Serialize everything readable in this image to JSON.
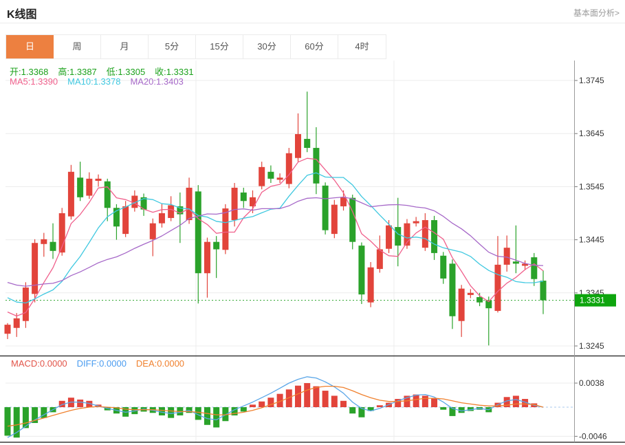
{
  "header": {
    "title": "K线图",
    "analysis_link": "基本面分析>"
  },
  "tabs": [
    {
      "id": "day",
      "label": "日",
      "active": true
    },
    {
      "id": "week",
      "label": "周",
      "active": false
    },
    {
      "id": "month",
      "label": "月",
      "active": false
    },
    {
      "id": "5min",
      "label": "5分",
      "active": false
    },
    {
      "id": "15min",
      "label": "15分",
      "active": false
    },
    {
      "id": "30min",
      "label": "30分",
      "active": false
    },
    {
      "id": "60min",
      "label": "60分",
      "active": false
    },
    {
      "id": "4hour",
      "label": "4时",
      "active": false
    }
  ],
  "ohlc_legend": {
    "color": "#1ba11b",
    "items": [
      {
        "label": "开:",
        "value": "1.3368"
      },
      {
        "label": "高:",
        "value": "1.3387"
      },
      {
        "label": "低:",
        "value": "1.3305"
      },
      {
        "label": "收:",
        "value": "1.3331"
      }
    ]
  },
  "ma_legend": [
    {
      "label": "MA5:",
      "value": "1.3390",
      "color": "#f0608c"
    },
    {
      "label": "MA10:",
      "value": "1.3378",
      "color": "#3fc8e0"
    },
    {
      "label": "MA20:",
      "value": "1.3403",
      "color": "#a668c8"
    }
  ],
  "macd_legend": [
    {
      "label": "MACD:",
      "value": "0.0000",
      "color": "#e25449"
    },
    {
      "label": "DIFF:",
      "value": "0.0000",
      "color": "#4a9cf0"
    },
    {
      "label": "DEA:",
      "value": "0.0000",
      "color": "#f0812e"
    }
  ],
  "price_badge": {
    "label": "1.3331",
    "color": "#0ea50e"
  },
  "colors": {
    "up": "#e2443b",
    "down": "#2aa22a",
    "grid": "#ececec",
    "axis": "#9a9a9a",
    "panel_border": "#3a3a3a",
    "ma5": "#f0608c",
    "ma10": "#3fc8e0",
    "ma20": "#a668c8",
    "diff": "#5aa6e8",
    "dea": "#f0812e",
    "zero_line": "#a9c9ec",
    "tick_text": "#333333",
    "dotted_price_line": "#2aa22a"
  },
  "chart_data": {
    "type": "candlestick+macd",
    "title": "K线图 daily candlestick with MA5/MA10/MA20 and MACD",
    "y_ticks": [
      {
        "price": 1.3745,
        "label": "1.3745"
      },
      {
        "price": 1.3645,
        "label": "1.3645"
      },
      {
        "price": 1.3545,
        "label": "1.3545"
      },
      {
        "price": 1.3445,
        "label": "1.3445"
      },
      {
        "price": 1.3345,
        "label": "1.3345"
      },
      {
        "price": 1.3245,
        "label": "1.3245"
      }
    ],
    "last_price": 1.3331,
    "ma_windows": [
      5,
      10,
      20
    ],
    "ma_seed": [
      1.34,
      1.3398,
      1.3396,
      1.34,
      1.3402,
      1.3398,
      1.3392,
      1.3388,
      1.3385,
      1.339,
      1.3386,
      1.338,
      1.3372,
      1.3362,
      1.3355,
      1.3345,
      1.3335,
      1.3322,
      1.3308,
      1.3295
    ],
    "candles": [
      [
        1.3268,
        1.3285,
        1.3288,
        1.3258
      ],
      [
        1.3279,
        1.3297,
        1.3307,
        1.3262
      ],
      [
        1.3292,
        1.3355,
        1.3365,
        1.3279
      ],
      [
        1.3343,
        1.3439,
        1.3446,
        1.3327
      ],
      [
        1.3437,
        1.3446,
        1.3458,
        1.3413
      ],
      [
        1.3441,
        1.3424,
        1.3476,
        1.3409
      ],
      [
        1.3421,
        1.3495,
        1.3505,
        1.3415
      ],
      [
        1.3489,
        1.3573,
        1.3586,
        1.3483
      ],
      [
        1.3562,
        1.3525,
        1.3592,
        1.3518
      ],
      [
        1.3528,
        1.356,
        1.3572,
        1.3522
      ],
      [
        1.3556,
        1.356,
        1.3568,
        1.3545
      ],
      [
        1.3555,
        1.3505,
        1.356,
        1.348
      ],
      [
        1.3505,
        1.347,
        1.3512,
        1.3445
      ],
      [
        1.3456,
        1.3508,
        1.3518,
        1.345
      ],
      [
        1.3505,
        1.3528,
        1.3538,
        1.3498
      ],
      [
        1.3525,
        1.3502,
        1.3532,
        1.349
      ],
      [
        1.3446,
        1.3476,
        1.3485,
        1.3414
      ],
      [
        1.3476,
        1.3495,
        1.3513,
        1.3468
      ],
      [
        1.3486,
        1.351,
        1.3527,
        1.348
      ],
      [
        1.3508,
        1.3493,
        1.3534,
        1.3439
      ],
      [
        1.3482,
        1.3543,
        1.3562,
        1.3475
      ],
      [
        1.3536,
        1.3382,
        1.3548,
        1.3325
      ],
      [
        1.3382,
        1.3441,
        1.3449,
        1.3336
      ],
      [
        1.3441,
        1.3427,
        1.3452,
        1.3373
      ],
      [
        1.3426,
        1.3504,
        1.3512,
        1.3418
      ],
      [
        1.3482,
        1.3543,
        1.3552,
        1.347
      ],
      [
        1.3534,
        1.3518,
        1.3543,
        1.3505
      ],
      [
        1.3508,
        1.3525,
        1.3538,
        1.3495
      ],
      [
        1.3546,
        1.3582,
        1.3592,
        1.354
      ],
      [
        1.3573,
        1.356,
        1.3585,
        1.3552
      ],
      [
        1.3558,
        1.3562,
        1.357,
        1.3552
      ],
      [
        1.355,
        1.3608,
        1.3618,
        1.3542
      ],
      [
        1.3599,
        1.3644,
        1.3683,
        1.3592
      ],
      [
        1.3635,
        1.3618,
        1.3724,
        1.361
      ],
      [
        1.3618,
        1.3551,
        1.3657,
        1.3531
      ],
      [
        1.3547,
        1.3463,
        1.3553,
        1.3455
      ],
      [
        1.3456,
        1.3511,
        1.352,
        1.3448
      ],
      [
        1.3508,
        1.3525,
        1.3538,
        1.35
      ],
      [
        1.3524,
        1.3441,
        1.353,
        1.3427
      ],
      [
        1.3434,
        1.3342,
        1.344,
        1.3324
      ],
      [
        1.3327,
        1.3393,
        1.3403,
        1.3318
      ],
      [
        1.339,
        1.3427,
        1.3453,
        1.3383
      ],
      [
        1.3428,
        1.3472,
        1.3482,
        1.342
      ],
      [
        1.3469,
        1.3434,
        1.3524,
        1.3395
      ],
      [
        1.3434,
        1.3476,
        1.3484,
        1.3428
      ],
      [
        1.3476,
        1.348,
        1.3488,
        1.347
      ],
      [
        1.343,
        1.3482,
        1.3495,
        1.3424
      ],
      [
        1.3482,
        1.342,
        1.349,
        1.3407
      ],
      [
        1.3415,
        1.3372,
        1.3422,
        1.3362
      ],
      [
        1.34,
        1.3301,
        1.3408,
        1.3277
      ],
      [
        1.3292,
        1.3353,
        1.336,
        1.3262
      ],
      [
        1.3341,
        1.3345,
        1.3352,
        1.3335
      ],
      [
        1.3337,
        1.3327,
        1.3345,
        1.332
      ],
      [
        1.3331,
        1.3316,
        1.3338,
        1.3246
      ],
      [
        1.3311,
        1.3398,
        1.3452,
        1.3308
      ],
      [
        1.3398,
        1.343,
        1.3453,
        1.3385
      ],
      [
        1.3404,
        1.34,
        1.3472,
        1.3382
      ],
      [
        1.3396,
        1.34,
        1.3406,
        1.3388
      ],
      [
        1.3412,
        1.3371,
        1.342,
        1.3358
      ],
      [
        1.3368,
        1.3331,
        1.3387,
        1.3305
      ]
    ],
    "macd": {
      "unit": 0.0001,
      "ticks": [
        {
          "value": 38,
          "label": "0.0038"
        },
        {
          "value": -46,
          "label": "-0.0046"
        }
      ],
      "hist": [
        -45,
        -48,
        -33,
        -25,
        -17,
        -8,
        10,
        15,
        12,
        10,
        4,
        -5,
        -10,
        -15,
        -11,
        -7,
        -9,
        -13,
        -17,
        -13,
        -9,
        -20,
        -28,
        -32,
        -22,
        -13,
        -7,
        4,
        9,
        15,
        21,
        28,
        34,
        38,
        33,
        26,
        18,
        10,
        -10,
        -16,
        -6,
        3,
        7,
        13,
        18,
        20,
        18,
        14,
        -4,
        -14,
        -9,
        -6,
        -4,
        -8,
        7,
        16,
        18,
        13,
        6,
        0
      ],
      "diff": [
        -48,
        -40,
        -30,
        -20,
        -12,
        -4,
        4,
        8,
        8,
        6,
        2,
        -2,
        -5,
        -8,
        -6,
        -3,
        -5,
        -8,
        -10,
        -8,
        -5,
        -12,
        -18,
        -20,
        -12,
        -4,
        2,
        8,
        15,
        22,
        30,
        38,
        44,
        48,
        46,
        40,
        32,
        22,
        8,
        -2,
        -6,
        -2,
        4,
        10,
        15,
        19,
        20,
        16,
        8,
        -2,
        -6,
        -4,
        -2,
        -4,
        4,
        10,
        12,
        8,
        3,
        0
      ],
      "dea": [
        -30,
        -28,
        -25,
        -21,
        -17,
        -13,
        -9,
        -5,
        -2,
        0,
        1,
        0,
        -1,
        -3,
        -4,
        -4,
        -4,
        -5,
        -6,
        -7,
        -7,
        -8,
        -10,
        -12,
        -12,
        -10,
        -8,
        -5,
        -1,
        4,
        9,
        15,
        21,
        27,
        31,
        33,
        33,
        31,
        26,
        20,
        15,
        11,
        9,
        9,
        10,
        12,
        14,
        14,
        13,
        10,
        7,
        5,
        3,
        2,
        2,
        3,
        5,
        5,
        4,
        0
      ]
    }
  }
}
